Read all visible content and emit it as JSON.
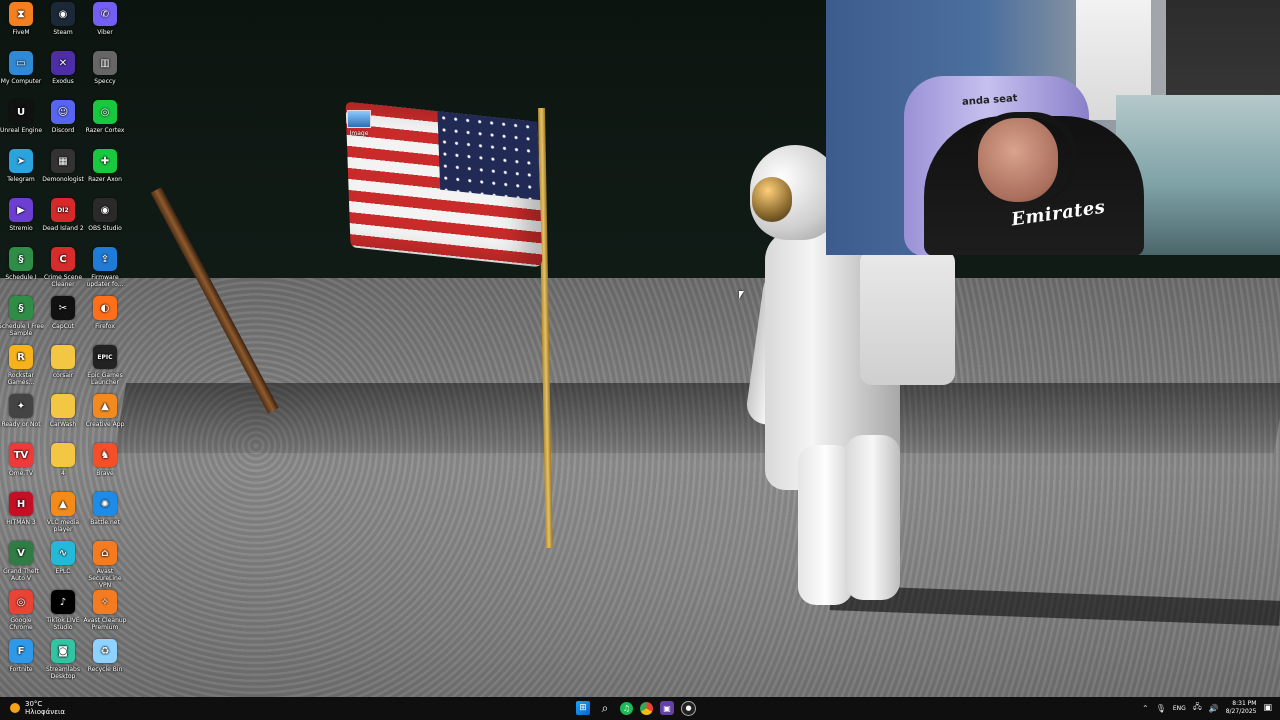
{
  "desktop": {
    "icons": [
      {
        "label": "FiveM",
        "icon": "fivem-icon",
        "color": "#f47f20",
        "glyph": "⧗"
      },
      {
        "label": "Steam",
        "icon": "steam-icon",
        "color": "#1b2838",
        "glyph": "◉"
      },
      {
        "label": "Viber",
        "icon": "viber-icon",
        "color": "#7360f2",
        "glyph": "✆"
      },
      {
        "label": "My Computer",
        "icon": "computer-icon",
        "color": "#2f89d5",
        "glyph": "▭"
      },
      {
        "label": "Exodus",
        "icon": "exodus-icon",
        "color": "#4d2ea8",
        "glyph": "✕"
      },
      {
        "label": "Speccy",
        "icon": "speccy-icon",
        "color": "#666",
        "glyph": "▥"
      },
      {
        "label": "Unreal Engine",
        "icon": "unreal-engine-icon",
        "color": "#111",
        "glyph": "U"
      },
      {
        "label": "Discord",
        "icon": "discord-icon",
        "color": "#5865f2",
        "glyph": "☺"
      },
      {
        "label": "Razer Cortex",
        "icon": "razer-cortex-icon",
        "color": "#18c93f",
        "glyph": "◎"
      },
      {
        "label": "Telegram",
        "icon": "telegram-icon",
        "color": "#2aa3df",
        "glyph": "➤"
      },
      {
        "label": "Demonologist",
        "icon": "demonologist-icon",
        "color": "#333",
        "glyph": "▦"
      },
      {
        "label": "Razer Axon",
        "icon": "razer-axon-icon",
        "color": "#18c93f",
        "glyph": "✚"
      },
      {
        "label": "Stremio",
        "icon": "stremio-icon",
        "color": "#6c3fd2",
        "glyph": "▶"
      },
      {
        "label": "Dead Island 2",
        "icon": "dead-island-2-icon",
        "color": "#d62929",
        "glyph": "DI2"
      },
      {
        "label": "OBS Studio",
        "icon": "obs-studio-icon",
        "color": "#2a2a2a",
        "glyph": "◉"
      },
      {
        "label": "Schedule I",
        "icon": "schedule-i-icon",
        "color": "#2f8d47",
        "glyph": "§"
      },
      {
        "label": "Crime Scene Cleaner",
        "icon": "crime-scene-cleaner-icon",
        "color": "#d82b2b",
        "glyph": "C"
      },
      {
        "label": "Firmware updater fo...",
        "icon": "firmware-updater-icon",
        "color": "#1e7bd7",
        "glyph": "⇪"
      },
      {
        "label": "Schedule I Free Sample",
        "icon": "schedule-i-free-sample-icon",
        "color": "#2f8d47",
        "glyph": "§"
      },
      {
        "label": "CapCut",
        "icon": "capcut-icon",
        "color": "#111",
        "glyph": "✂"
      },
      {
        "label": "Firefox",
        "icon": "firefox-icon",
        "color": "#ff6e19",
        "glyph": "◐"
      },
      {
        "label": "Rockstar Games...",
        "icon": "rockstar-games-icon",
        "color": "#f5b21d",
        "glyph": "R"
      },
      {
        "label": "corsair",
        "icon": "folder-icon",
        "color": "#f3c743",
        "glyph": ""
      },
      {
        "label": "Epic Games Launcher",
        "icon": "epic-games-icon",
        "color": "#222",
        "glyph": "EPIC"
      },
      {
        "label": "Ready or Not",
        "icon": "ready-or-not-icon",
        "color": "#444",
        "glyph": "✦"
      },
      {
        "label": "CarWash",
        "icon": "folder-icon",
        "color": "#f3c743",
        "glyph": ""
      },
      {
        "label": "Creative App",
        "icon": "creative-app-icon",
        "color": "#f28a1f",
        "glyph": "▲"
      },
      {
        "label": "Ome.TV",
        "icon": "ome-tv-icon",
        "color": "#f03a3a",
        "glyph": "TV"
      },
      {
        "label": "4",
        "icon": "folder-icon",
        "color": "#f3c743",
        "glyph": ""
      },
      {
        "label": "Brave",
        "icon": "brave-icon",
        "color": "#f54f2a",
        "glyph": "♞"
      },
      {
        "label": "HITMAN 3",
        "icon": "hitman-3-icon",
        "color": "#c60f24",
        "glyph": "H"
      },
      {
        "label": "VLC media player",
        "icon": "vlc-icon",
        "color": "#f48b18",
        "glyph": "▲"
      },
      {
        "label": "Battle.net",
        "icon": "battle-net-icon",
        "color": "#1d8be8",
        "glyph": "✺"
      },
      {
        "label": "Grand Theft Auto V",
        "icon": "gta-v-icon",
        "color": "#2f7d44",
        "glyph": "V"
      },
      {
        "label": "EPLC",
        "icon": "eplc-icon",
        "color": "#24b8d9",
        "glyph": "∿"
      },
      {
        "label": "Avast SecureLine VPN",
        "icon": "avast-vpn-icon",
        "color": "#f47b20",
        "glyph": "⌂"
      },
      {
        "label": "Google Chrome",
        "icon": "chrome-icon",
        "color": "#e84335",
        "glyph": "◎"
      },
      {
        "label": "TikTok LIVE Studio",
        "icon": "tiktok-live-icon",
        "color": "#000",
        "glyph": "♪"
      },
      {
        "label": "Avast Cleanup Premium",
        "icon": "avast-cleanup-icon",
        "color": "#f47b20",
        "glyph": "✧"
      },
      {
        "label": "Fortnite",
        "icon": "fortnite-icon",
        "color": "#2f99e9",
        "glyph": "F"
      },
      {
        "label": "Streamlabs Desktop",
        "icon": "streamlabs-icon",
        "color": "#31c3a2",
        "glyph": "◙"
      },
      {
        "label": "Recycle Bin",
        "icon": "recycle-bin-icon",
        "color": "#8fd1ff",
        "glyph": "♻"
      }
    ],
    "image_file_label": "Image"
  },
  "webcam": {
    "chair_brand": "anda seat",
    "jersey_text": "Emirates"
  },
  "taskbar": {
    "weather": {
      "temp": "30°C",
      "condition": "Ηλιοφάνεια"
    },
    "lang": "ENG",
    "time": "8:31 PM",
    "date": "8/27/2025"
  }
}
